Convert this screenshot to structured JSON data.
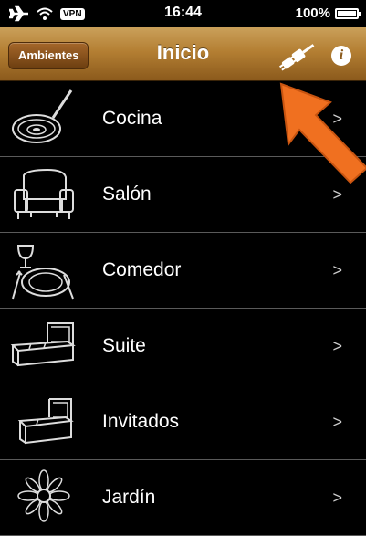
{
  "status_bar": {
    "vpn_label": "VPN",
    "time": "16:44",
    "battery": "100%"
  },
  "nav": {
    "back_label": "Ambientes",
    "title": "Inicio",
    "plug_icon": "plug-icon",
    "info_label": "i"
  },
  "rows": [
    {
      "label": "Cocina",
      "icon": "frying-pan-icon",
      "chevron": ">"
    },
    {
      "label": "Salón",
      "icon": "armchair-icon",
      "chevron": ">"
    },
    {
      "label": "Comedor",
      "icon": "dinner-plate-icon",
      "chevron": ">"
    },
    {
      "label": "Suite",
      "icon": "bed-icon",
      "chevron": ">"
    },
    {
      "label": "Invitados",
      "icon": "bed-icon",
      "chevron": ">"
    },
    {
      "label": "Jardín",
      "icon": "flower-icon",
      "chevron": ">"
    }
  ],
  "colors": {
    "accent_arrow": "#f07020",
    "nav_bar": "#b47f33"
  }
}
